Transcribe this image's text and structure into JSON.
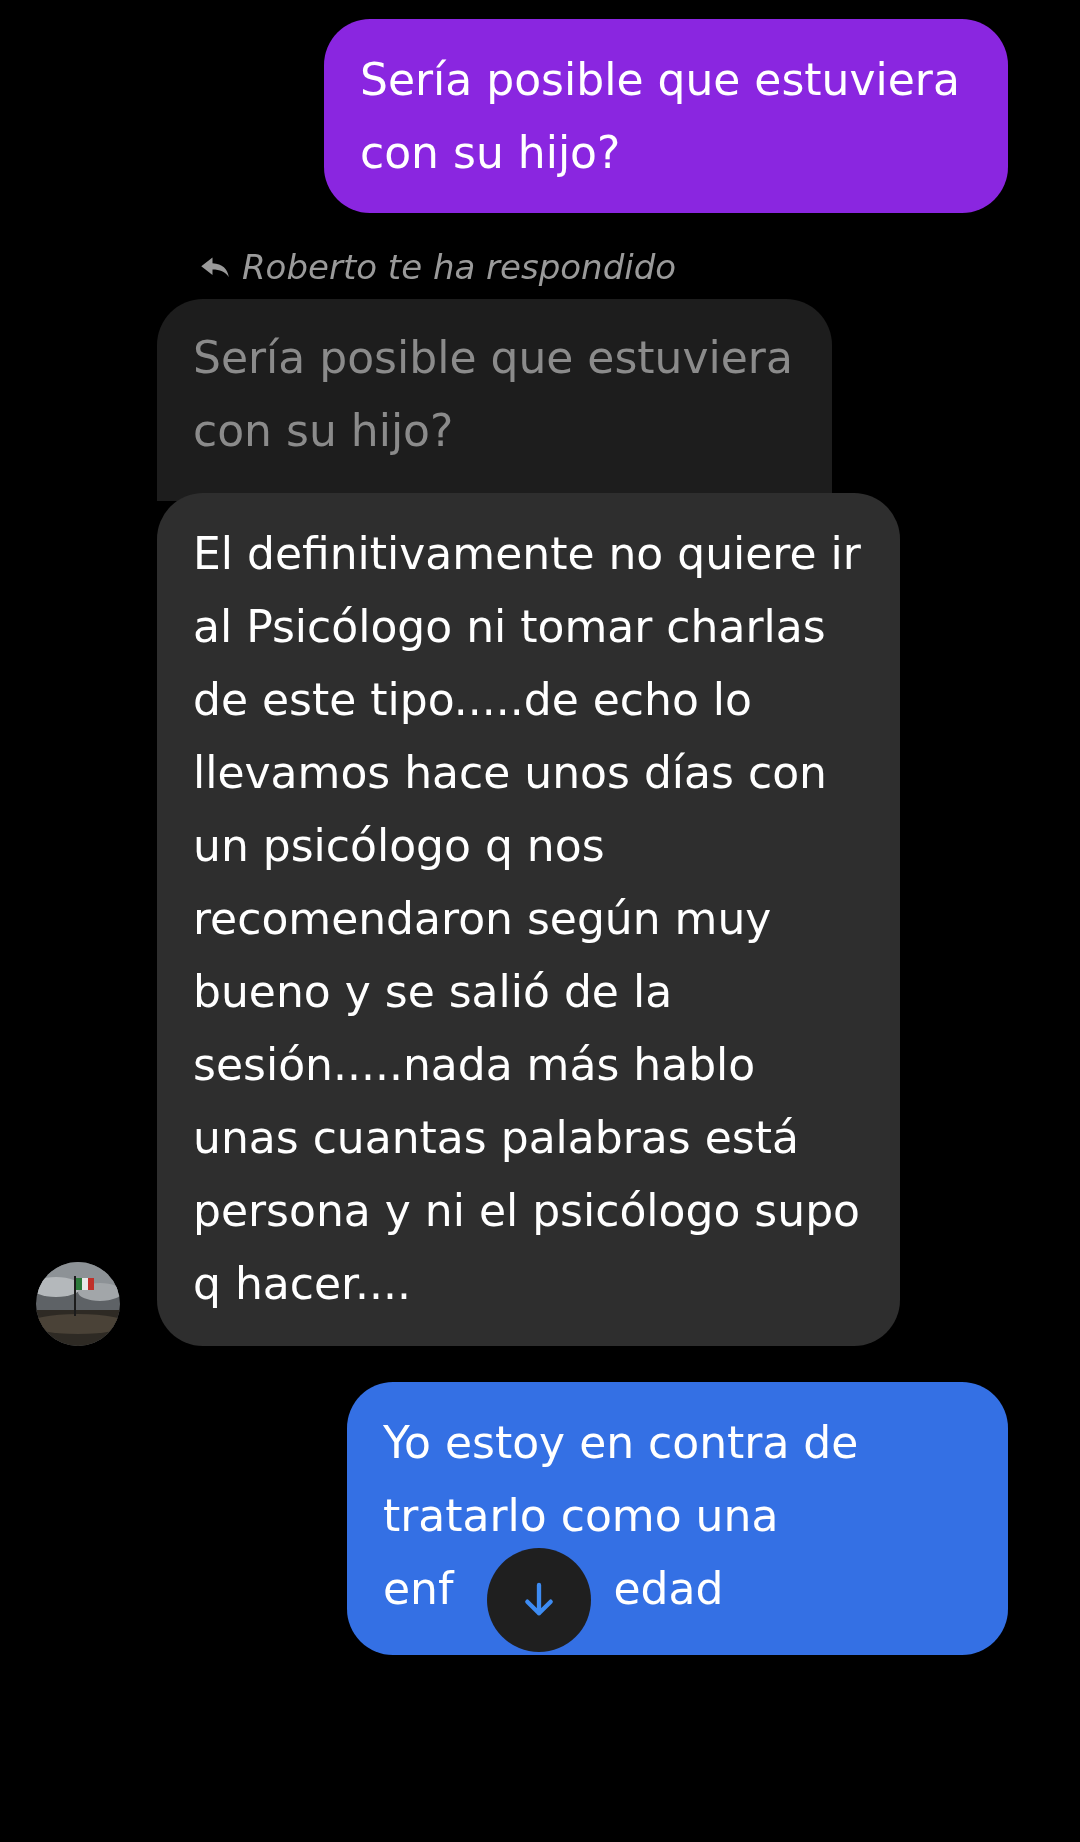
{
  "messages": [
    {
      "kind": "sent",
      "color": "#8a26e0",
      "text": "Sería posible que estuviera con su hijo?"
    },
    {
      "kind": "received",
      "reply_label": "Roberto te ha respondido",
      "quoted": "Sería posible que estuviera con su hijo?",
      "text": "El definitivamente no quiere ir al Psicólogo ni tomar charlas de este tipo.....de echo lo llevamos hace unos días con un psicólogo q nos recomendaron según muy bueno y se salió de la sesión.....nada más hablo unas cuantas palabras está persona y ni el psicólogo supo q hacer...."
    },
    {
      "kind": "sent",
      "color": "#3470e4",
      "text": "Yo estoy en contra de tratarlo como una",
      "covered_line": [
        "enf",
        "edad"
      ]
    }
  ]
}
